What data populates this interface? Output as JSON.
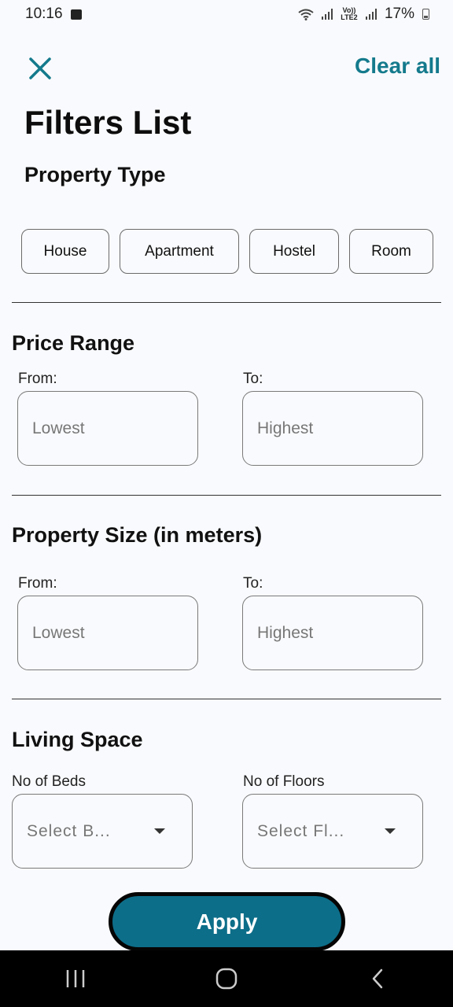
{
  "status_bar": {
    "time": "10:16",
    "signal_label": "Vo)) LTE2",
    "battery": "17%"
  },
  "header": {
    "close_icon": "close-icon",
    "clear_all": "Clear all",
    "title": "Filters List"
  },
  "property_type": {
    "title": "Property Type",
    "options": [
      "House",
      "Apartment",
      "Hostel",
      "Room"
    ]
  },
  "price_range": {
    "title": "Price Range",
    "from_label": "From:",
    "to_label": "To:",
    "from_placeholder": "Lowest",
    "to_placeholder": "Highest"
  },
  "property_size": {
    "title": "Property Size (in meters)",
    "from_label": "From:",
    "to_label": "To:",
    "from_placeholder": "Lowest",
    "to_placeholder": "Highest"
  },
  "living_space": {
    "title": "Living Space",
    "beds_label": "No of Beds",
    "floors_label": "No of Floors",
    "beds_value": "Select B...",
    "floors_value": "Select Fl..."
  },
  "apply_label": "Apply",
  "colors": {
    "accent": "#147a8c",
    "apply_bg": "#0d6e89",
    "background": "#f9fafd"
  }
}
